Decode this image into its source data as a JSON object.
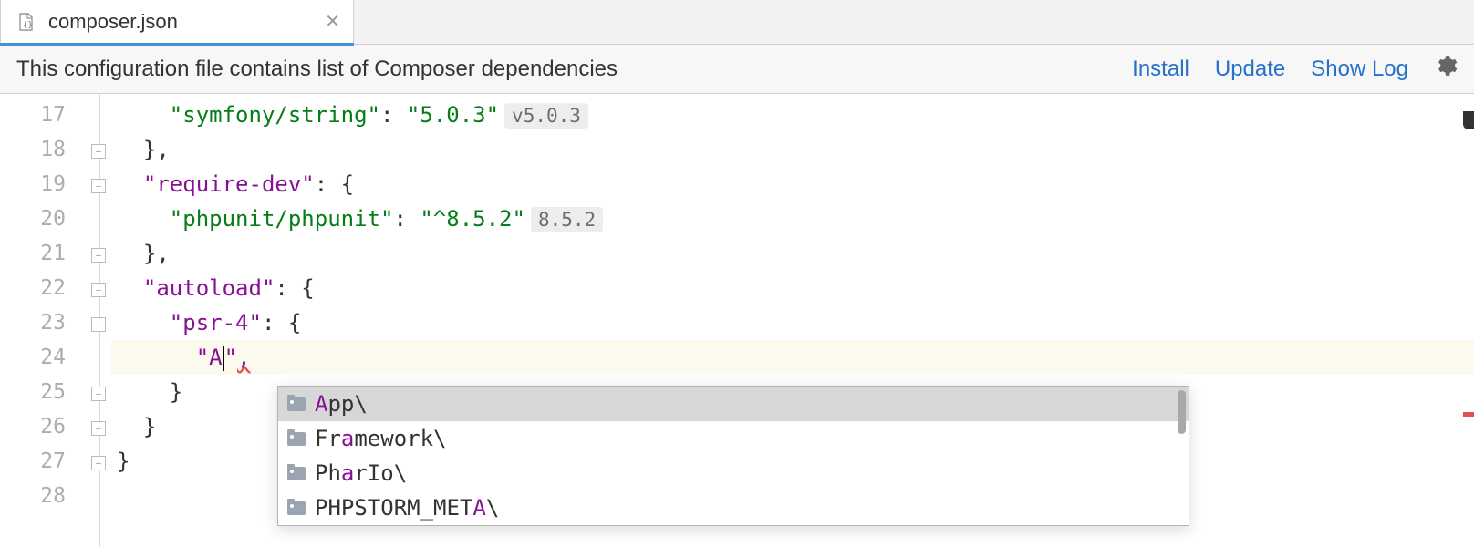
{
  "tab": {
    "filename": "composer.json"
  },
  "info_bar": {
    "message": "This configuration file contains list of Composer dependencies",
    "install": "Install",
    "update": "Update",
    "show_log": "Show Log"
  },
  "gutter": {
    "lines": [
      "17",
      "18",
      "19",
      "20",
      "21",
      "22",
      "23",
      "24",
      "25",
      "26",
      "27",
      "28"
    ]
  },
  "code": {
    "l17_key": "\"symfony/string\"",
    "l17_colon": ": ",
    "l17_val": "\"5.0.3\"",
    "l17_badge": "v5.0.3",
    "l18": "},",
    "l19_key": "\"require-dev\"",
    "l19_rest": ": {",
    "l20_key": "\"phpunit/phpunit\"",
    "l20_colon": ": ",
    "l20_val": "\"^8.5.2\"",
    "l20_badge": "8.5.2",
    "l21": "},",
    "l22_key": "\"autoload\"",
    "l22_rest": ": {",
    "l23_key": "\"psr-4\"",
    "l23_rest": ": {",
    "l24_open": "\"A",
    "l24_close_punct": "\"",
    "l24_close_squiggle": ",",
    "l25": "}",
    "l26": "}",
    "l27": "}"
  },
  "autocomplete": [
    {
      "pre": "",
      "match": "A",
      "post": "pp\\",
      "selected": true
    },
    {
      "pre": "Fr",
      "match": "a",
      "post": "mework\\",
      "selected": false
    },
    {
      "pre": "Ph",
      "match": "a",
      "post": "rIo\\",
      "selected": false
    },
    {
      "pre": "PHPSTORM_MET",
      "match": "A",
      "post": "\\",
      "selected": false
    }
  ]
}
